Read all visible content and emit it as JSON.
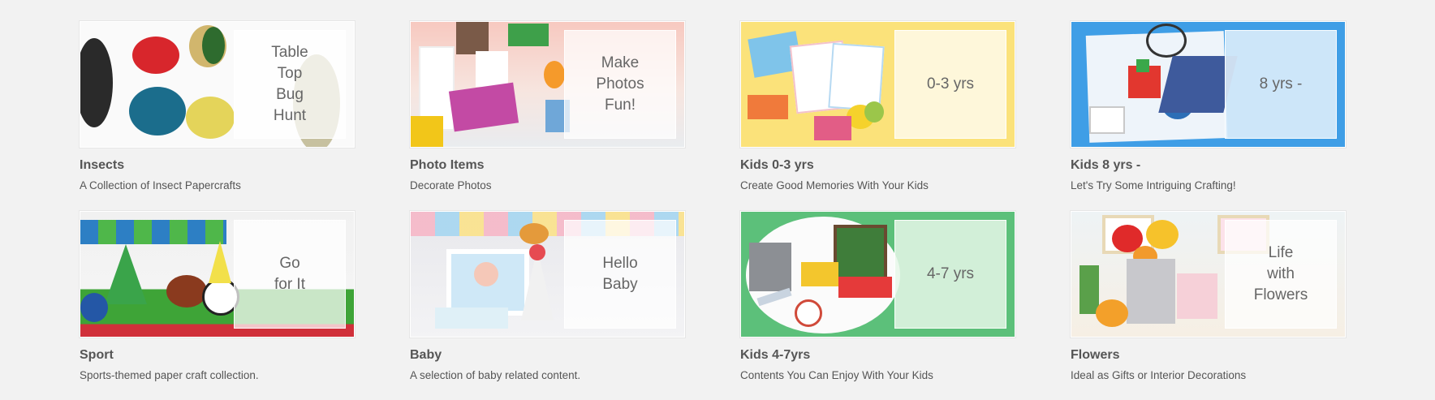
{
  "cards": [
    {
      "title": "Insects",
      "description": "A Collection of Insect Papercrafts",
      "overlay": "Table\nTop\nBug\nHunt",
      "image": "insect-papercrafts-image"
    },
    {
      "title": "Photo Items",
      "description": "Decorate Photos",
      "overlay": "Make\nPhotos\nFun!",
      "image": "photo-items-image"
    },
    {
      "title": "Kids 0-3 yrs",
      "description": "Create Good Memories With Your Kids",
      "overlay": "0-3 yrs",
      "image": "kids-0-3-image"
    },
    {
      "title": "Kids 8 yrs -",
      "description": "Let's Try Some Intriguing Crafting!",
      "overlay": "8 yrs -",
      "image": "kids-8-image"
    },
    {
      "title": "Sport",
      "description": "Sports-themed paper craft collection.",
      "overlay": "Go\nfor It",
      "image": "sport-image"
    },
    {
      "title": "Baby",
      "description": "A selection of baby related content.",
      "overlay": "Hello\nBaby",
      "image": "baby-image"
    },
    {
      "title": "Kids 4-7yrs",
      "description": "Contents You Can Enjoy With Your Kids",
      "overlay": "4-7 yrs",
      "image": "kids-4-7-image"
    },
    {
      "title": "Flowers",
      "description": "Ideal as Gifts or Interior Decorations",
      "overlay": "Life\nwith\nFlowers",
      "image": "flowers-image"
    }
  ]
}
